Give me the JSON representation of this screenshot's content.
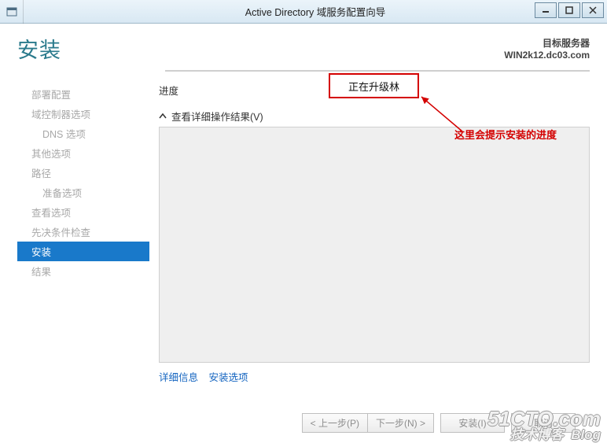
{
  "titlebar": {
    "title": "Active Directory 域服务配置向导"
  },
  "header": {
    "page_title": "安装",
    "target_label": "目标服务器",
    "target_value": "WIN2k12.dc03.com"
  },
  "nav": {
    "items": [
      {
        "label": "部署配置",
        "indent": 1
      },
      {
        "label": "域控制器选项",
        "indent": 1
      },
      {
        "label": "DNS 选项",
        "indent": 2
      },
      {
        "label": "其他选项",
        "indent": 1
      },
      {
        "label": "路径",
        "indent": 1
      },
      {
        "label": "准备选项",
        "indent": 2
      },
      {
        "label": "查看选项",
        "indent": 1
      },
      {
        "label": "先决条件检查",
        "indent": 1
      },
      {
        "label": "安装",
        "indent": 1,
        "active": true
      },
      {
        "label": "结果",
        "indent": 1
      }
    ]
  },
  "main": {
    "progress_label": "进度",
    "expander_label": "查看详细操作结果(V)",
    "callout_status": "正在升级林",
    "callout_hint": "这里会提示安装的进度",
    "link_details": "详细信息",
    "link_options": "安装选项"
  },
  "footer": {
    "prev": "< 上一步(P)",
    "next": "下一步(N) >",
    "install": "安装(I)",
    "cancel": "取消"
  },
  "watermark": {
    "line1": "51CTO.com",
    "line2": "技术博客",
    "tag": "Blog"
  }
}
